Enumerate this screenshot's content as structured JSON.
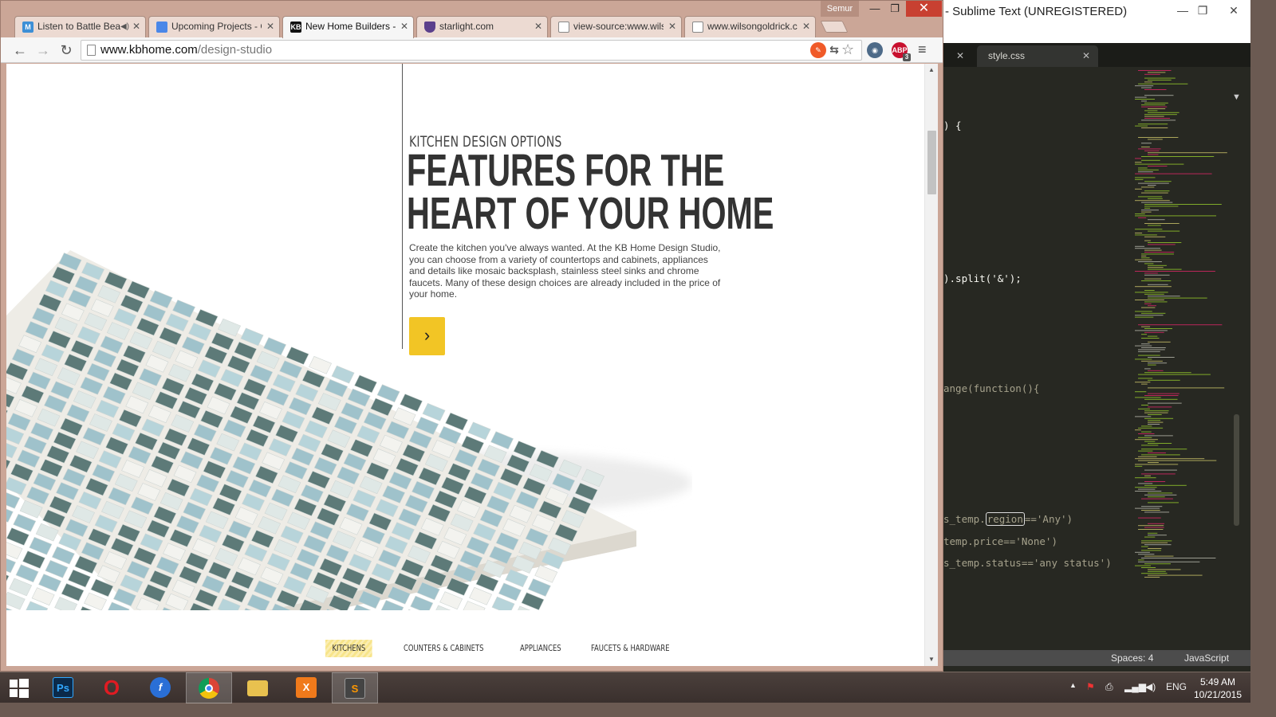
{
  "browser": {
    "profile_name": "Semur",
    "tabs": [
      {
        "label": "Listen to Battle Bea",
        "favicon": "M",
        "favicon_color": "#3d8fd6",
        "has_audio": true
      },
      {
        "label": "Upcoming Projects - G",
        "favicon": "≡",
        "favicon_color": "#4a87e8",
        "has_audio": false
      },
      {
        "label": "New Home Builders -",
        "favicon": "KB",
        "favicon_color": "#111111",
        "has_audio": false,
        "active": true
      },
      {
        "label": "starlight.com",
        "favicon": "",
        "favicon_color": "#5b3f8c",
        "has_audio": false
      },
      {
        "label": "view-source:www.wils",
        "favicon": "",
        "favicon_color": "#ffffff",
        "has_audio": false
      },
      {
        "label": "www.wilsongoldrick.co",
        "favicon": "",
        "favicon_color": "#ffffff",
        "has_audio": false
      }
    ],
    "url_host": "www.kbhome.com",
    "url_path": "/design-studio",
    "extensions": {
      "abp_label": "ABP",
      "abp_count": "3"
    }
  },
  "page": {
    "kicker": "KITCHEN DESIGN OPTIONS",
    "headline_line1": "FEATURES FOR THE",
    "headline_line2": "HEART OF YOUR HOME",
    "body": "Create the kitchen you've always wanted. At the KB Home Design Studio, you can choose from a variety of countertops and cabinets, appliances and details like mosaic backsplash, stainless steel sinks and chrome faucets. Many of these design choices are already included in the price of your home.",
    "cta_icon": "chevron-right-icon",
    "subnav": [
      {
        "label": "KITCHENS",
        "active": true
      },
      {
        "label": "COUNTERS & CABINETS",
        "active": false
      },
      {
        "label": "APPLIANCES",
        "active": false
      },
      {
        "label": "FAUCETS & HARDWARE",
        "active": false
      }
    ],
    "accent_color": "#f2c525"
  },
  "sublime": {
    "title": "- Sublime Text (UNREGISTERED)",
    "tabs": [
      {
        "label": ""
      },
      {
        "label": "style.css"
      }
    ],
    "code_lines": [
      {
        "text": ") {"
      },
      {
        "text": ").split('&');"
      },
      {
        "text": "ange(function(){"
      },
      {
        "pre": "s_temp.",
        "boxed": "region",
        "post": "=='Any')"
      },
      {
        "text": "temp.price=='None')"
      },
      {
        "text": "s_temp.status=='any status')"
      }
    ],
    "status_spaces": "Spaces: 4",
    "status_syntax": "JavaScript"
  },
  "taskbar": {
    "apps": [
      {
        "name": "start",
        "icon": "windows-logo-icon"
      },
      {
        "name": "photoshop",
        "label": "Ps",
        "color": "#0b2a4a"
      },
      {
        "name": "opera",
        "label": "O",
        "color": "#d81c22"
      },
      {
        "name": "firefox-developer",
        "label": "f",
        "color": "#2a6fd6"
      },
      {
        "name": "chrome",
        "label": "",
        "color": "#4caf50",
        "active": true
      },
      {
        "name": "file-explorer",
        "label": "",
        "color": "#e8c14f"
      },
      {
        "name": "xampp",
        "label": "X",
        "color": "#f07a1b"
      },
      {
        "name": "sublime",
        "label": "S",
        "color": "#444444"
      }
    ],
    "language": "ENG",
    "time": "5:49 AM",
    "date": "10/21/2015"
  }
}
